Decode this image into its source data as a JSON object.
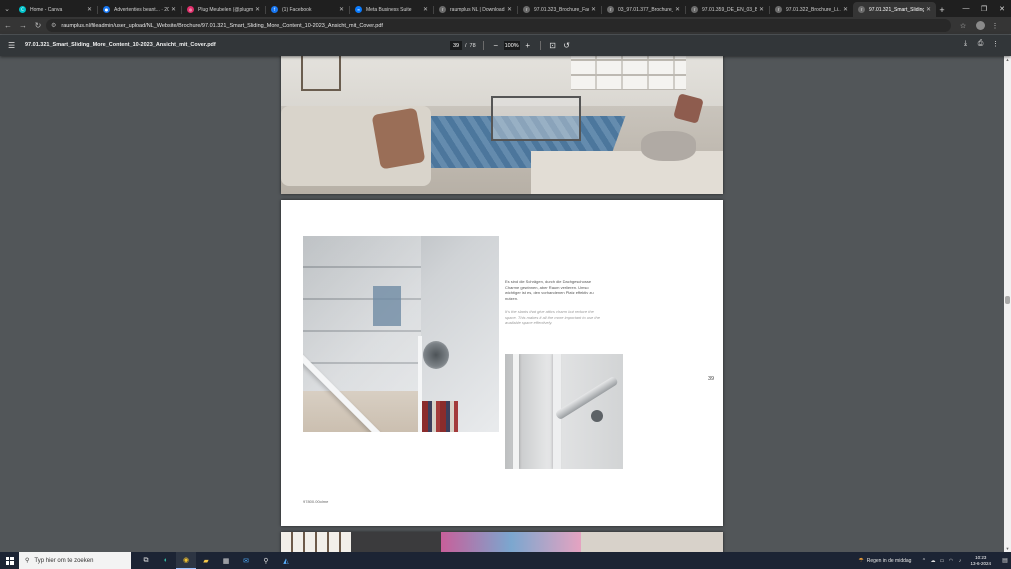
{
  "browser": {
    "tabs": [
      {
        "title": "Home - Canva",
        "favicon_color": "#00c4cc",
        "favicon_glyph": "C"
      },
      {
        "title": "Advertenties beant... · 2024",
        "favicon_color": "#1877f2",
        "favicon_glyph": "●"
      },
      {
        "title": "Plug Meubelen (@plugm...",
        "favicon_color": "#e1306c",
        "favicon_glyph": "◎"
      },
      {
        "title": "(1) Facebook",
        "favicon_color": "#1877f2",
        "favicon_glyph": "f"
      },
      {
        "title": "Meta Business Suite",
        "favicon_color": "#0a7cff",
        "favicon_glyph": "∞"
      },
      {
        "title": "raumplus NL | Download...",
        "favicon_color": "#6b6b6b",
        "favicon_glyph": "r"
      },
      {
        "title": "97.01.323_Brochure_Facet...",
        "favicon_color": "#6b6b6b",
        "favicon_glyph": "r"
      },
      {
        "title": "03_97.01.377_Brochure_...",
        "favicon_color": "#6b6b6b",
        "favicon_glyph": "r"
      },
      {
        "title": "97.01.359_DE_EN_03_BI...",
        "favicon_color": "#6b6b6b",
        "favicon_glyph": "r"
      },
      {
        "title": "97.01.322_Brochure_Li...",
        "favicon_color": "#6b6b6b",
        "favicon_glyph": "r"
      },
      {
        "title": "97.01.321_Smart_Sliding_",
        "favicon_color": "#6b6b6b",
        "favicon_glyph": "r",
        "active": true
      }
    ],
    "url": "raumplus.nl/fileadmin/user_upload/NL_Website/Brochure/97.01.321_Smart_Sliding_More_Content_10-2023_Ansicht_mit_Cover.pdf"
  },
  "pdf": {
    "title": "97.01.321_Smart_Sliding_More_Content_10-2023_Ansicht_mit_Cover.pdf",
    "current_page": "39",
    "total_pages": "78",
    "zoom": "100%"
  },
  "page": {
    "text_de": "Es sind die Schrägen, durch die Dachgeschosse Charme gewinnen, aber Raum verlieren. Umso wichtiger ist es, den vorhandenen Platz effektiv zu nutzen.",
    "text_en": "It's the slants that give attics charm but reduce the space. This makes it all the more important to use the available space effectively.",
    "page_number": "39",
    "footer_code": "97800.00olme"
  },
  "taskbar": {
    "search_placeholder": "Typ hier om te zoeken",
    "weather": "Regen in de middag",
    "time": "10:23",
    "date": "13-6-2024"
  }
}
